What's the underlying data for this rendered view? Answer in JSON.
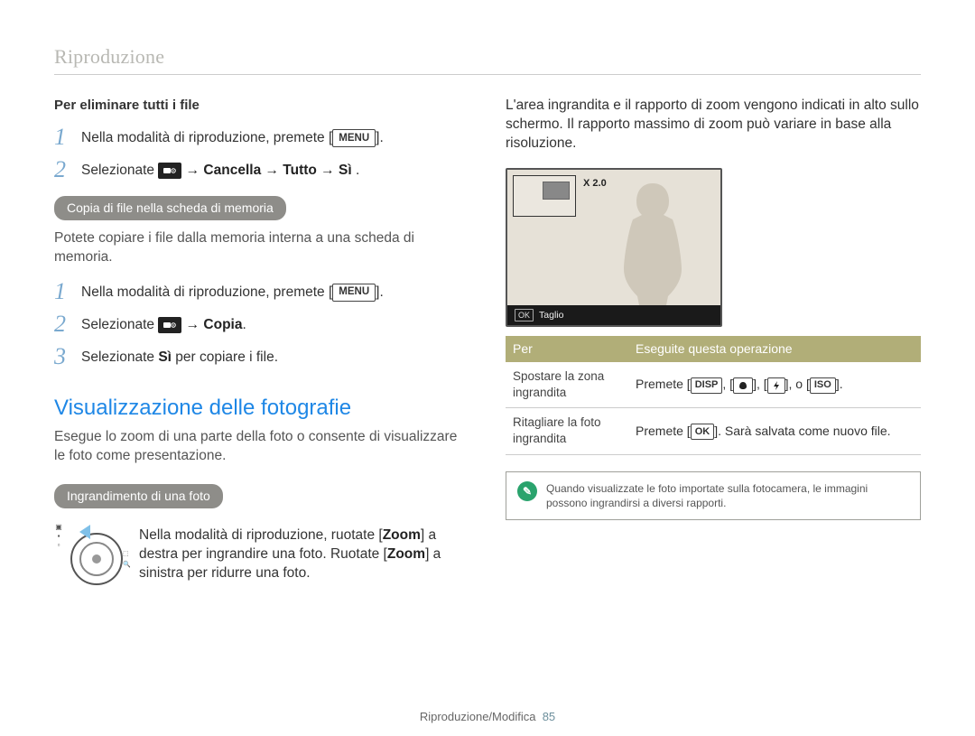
{
  "header": {
    "title": "Riproduzione"
  },
  "left": {
    "delete_all_heading": "Per eliminare tutti i file",
    "steps_delete": [
      {
        "num": "1",
        "prefix": "Nella modalità di riproduzione, premete [",
        "btn": "MENU",
        "suffix": "]."
      },
      {
        "num": "2",
        "prefix": "Selezionate ",
        "icon": "settings-icon",
        "path": " → Cancella → Tutto → Sì",
        "suffix": " ."
      }
    ],
    "copy_pill": "Copia di file nella scheda di memoria",
    "copy_body": "Potete copiare i file dalla memoria interna a una scheda di memoria.",
    "steps_copy": [
      {
        "num": "1",
        "prefix": "Nella modalità di riproduzione, premete [",
        "btn": "MENU",
        "suffix": "]."
      },
      {
        "num": "2",
        "prefix": "Selezionate ",
        "icon": "settings-icon",
        "path": " → Copia",
        "suffix": "."
      },
      {
        "num": "3",
        "prefix": "Selezionate ",
        "bold": "Sì",
        "suffix": " per copiare i file."
      }
    ],
    "section_title": "Visualizzazione delle fotografie",
    "section_body": "Esegue lo zoom di una parte della foto o consente di visualizzare le foto come presentazione.",
    "enlarge_pill": "Ingrandimento di una foto",
    "zoom_text": {
      "l1a": "Nella modalità di riproduzione, ruotate [",
      "zoom": "Zoom",
      "l1b": "] a destra per ingrandire una foto. Ruotate [",
      "l1c": "] a sinistra per ridurre una foto."
    }
  },
  "right": {
    "intro": "L'area ingrandita e il rapporto di zoom vengono indicati in alto sullo schermo. Il rapporto massimo di zoom può variare in base alla risoluzione.",
    "preview": {
      "zoom_label": "X 2.0",
      "ok": "OK",
      "trim": "Taglio"
    },
    "table": {
      "head_left": "Per",
      "head_right": "Eseguite questa operazione",
      "rows": [
        {
          "label": "Spostare la zona ingrandita",
          "action_prefix": "Premete [",
          "btns": [
            "DISP",
            "macro-icon",
            "flash-icon"
          ],
          "action_mid": "], o [",
          "last_btn": "ISO",
          "action_suffix": "]."
        },
        {
          "label": "Ritagliare la foto ingrandita",
          "action_prefix": "Premete [",
          "btns": [
            "OK"
          ],
          "action_suffix": "]. Sarà salvata come nuovo file."
        }
      ]
    },
    "note": "Quando visualizzate le foto importate sulla fotocamera, le immagini possono ingrandirsi a diversi rapporti."
  },
  "footer": {
    "section": "Riproduzione/Modifica",
    "page": "85"
  }
}
